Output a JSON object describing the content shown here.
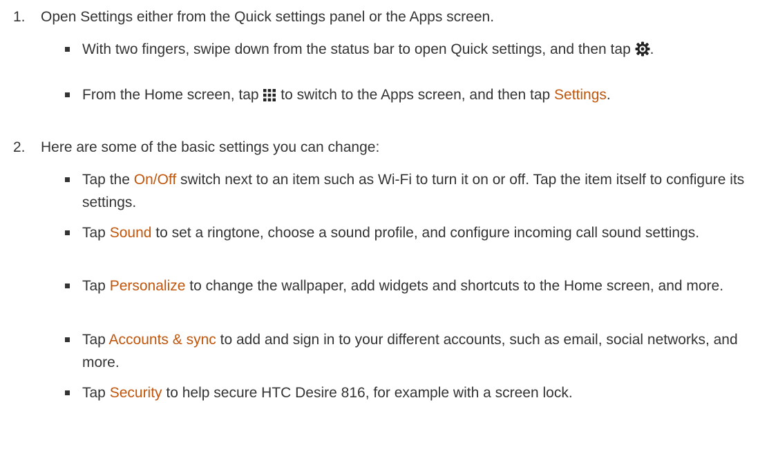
{
  "steps": [
    {
      "number": "1.",
      "text": "Open Settings either from the Quick settings panel or the Apps screen.",
      "bullets": [
        {
          "before": "With two fingers, swipe down from the status bar to open Quick settings, and then tap ",
          "icon": "gear-icon",
          "after": "."
        },
        {
          "before": "From the Home screen, tap ",
          "icon": "apps-grid-icon",
          "middle": " to switch to the Apps screen, and then tap ",
          "highlight": "Settings",
          "after": "."
        }
      ]
    },
    {
      "number": "2.",
      "text": "Here are some of the basic settings you can change:",
      "bullets": [
        {
          "before": "Tap the ",
          "highlight": "On/Off",
          "after": " switch next to an item such as Wi-Fi to turn it on or off. Tap the item itself to configure its settings."
        },
        {
          "before": "Tap ",
          "highlight": "Sound",
          "after": " to set a ringtone, choose a sound profile, and configure incoming call sound settings."
        },
        {
          "before": "Tap ",
          "highlight": "Personalize",
          "after": " to change the wallpaper, add widgets and shortcuts to the Home screen, and more."
        },
        {
          "before": "Tap ",
          "highlight": "Accounts & sync",
          "after": " to add and sign in to your different accounts, such as email, social networks, and more."
        },
        {
          "before": "Tap ",
          "highlight": "Security",
          "after": " to help secure HTC Desire 816, for example with a screen lock."
        }
      ]
    }
  ],
  "colors": {
    "text": "#333333",
    "highlight": "#c1550b"
  }
}
